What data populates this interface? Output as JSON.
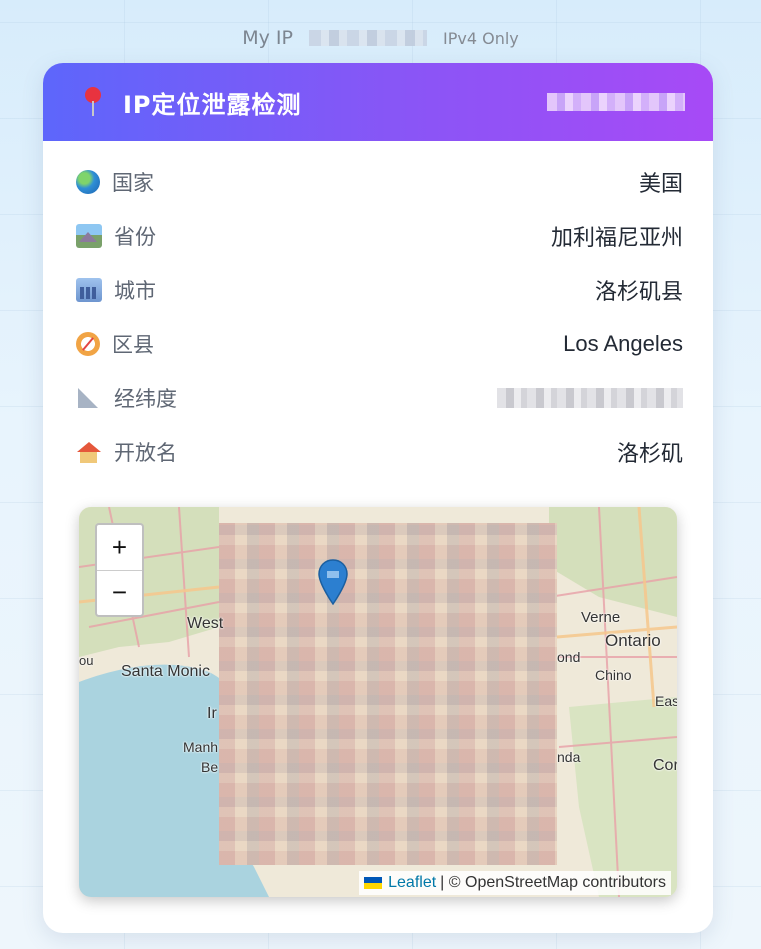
{
  "topbar": {
    "label": "My IP",
    "badge": "IPv4 Only"
  },
  "card": {
    "title": "IP定位泄露检测",
    "rows": [
      {
        "icon": "globe-icon",
        "key": "国家",
        "value": "美国"
      },
      {
        "icon": "mountain-icon",
        "key": "省份",
        "value": "加利福尼亚州"
      },
      {
        "icon": "city-icon",
        "key": "城市",
        "value": "洛杉矶县"
      },
      {
        "icon": "compass-icon",
        "key": "区县",
        "value": "Los Angeles"
      },
      {
        "icon": "ruler-icon",
        "key": "经纬度",
        "value": ""
      },
      {
        "icon": "house-icon",
        "key": "开放名",
        "value": "洛杉矶"
      }
    ]
  },
  "map": {
    "zoom_in": "+",
    "zoom_out": "−",
    "labels": [
      "West",
      "Santa Monic",
      "Ir",
      "Manh",
      "Be",
      "ou",
      "Verne",
      "Ontario",
      "ond",
      "Chino",
      "Eas",
      "nda",
      "Cor"
    ],
    "attribution_link": "Leaflet",
    "attribution_text": "| © OpenStreetMap contributors"
  },
  "colors": {
    "header_start": "#5d66fb",
    "header_end": "#a74af6",
    "marker": "#2c7fd0"
  }
}
